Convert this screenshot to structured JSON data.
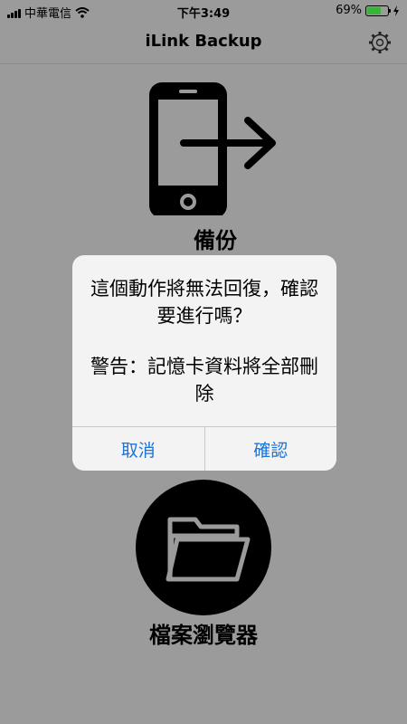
{
  "status_bar": {
    "carrier": "中華電信",
    "time": "下午3:49",
    "battery_percent": "69%",
    "battery_level": 0.69,
    "icons": [
      "signal-icon",
      "wifi-icon",
      "battery-icon",
      "charging-icon"
    ]
  },
  "nav": {
    "title": "iLink Backup",
    "settings_icon": "gear-icon"
  },
  "main": {
    "backup_label": "備份",
    "backup_icon": "phone-export-icon",
    "browser_label": "檔案瀏覽器",
    "browser_icon": "folder-icon"
  },
  "alert": {
    "message": "這個動作將無法回復，確認要進行嗎？",
    "warning": "警告：記憶卡資料將全部刪除",
    "cancel_label": "取消",
    "confirm_label": "確認"
  },
  "colors": {
    "background": "#9b9b9b",
    "alert_background": "#f3f3f3",
    "action_blue": "#1a73d9",
    "battery_green": "#3bb33b"
  }
}
